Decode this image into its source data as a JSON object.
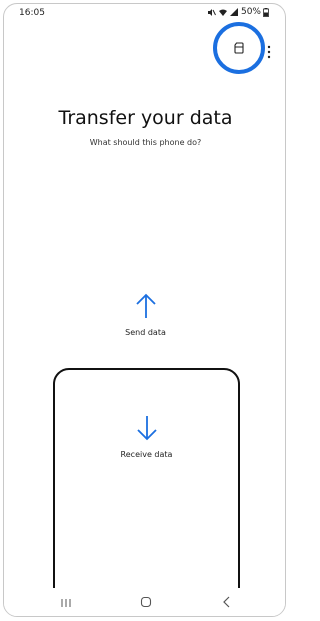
{
  "status_bar": {
    "time": "16:05",
    "battery_text": "50%",
    "icons": [
      "mute-icon",
      "wifi-icon",
      "signal-icon",
      "battery-icon"
    ]
  },
  "toolbar": {
    "icons": [
      "sd-card-icon",
      "more-options-icon"
    ],
    "highlight_color": "#1b6fe0"
  },
  "main": {
    "title": "Transfer your data",
    "subtitle": "What should this phone do?",
    "send_label": "Send data",
    "receive_label": "Receive data",
    "accent_color": "#1b6fe0"
  },
  "navigation_bar": {
    "icons": [
      "recent-apps-icon",
      "home-icon",
      "back-icon"
    ]
  }
}
